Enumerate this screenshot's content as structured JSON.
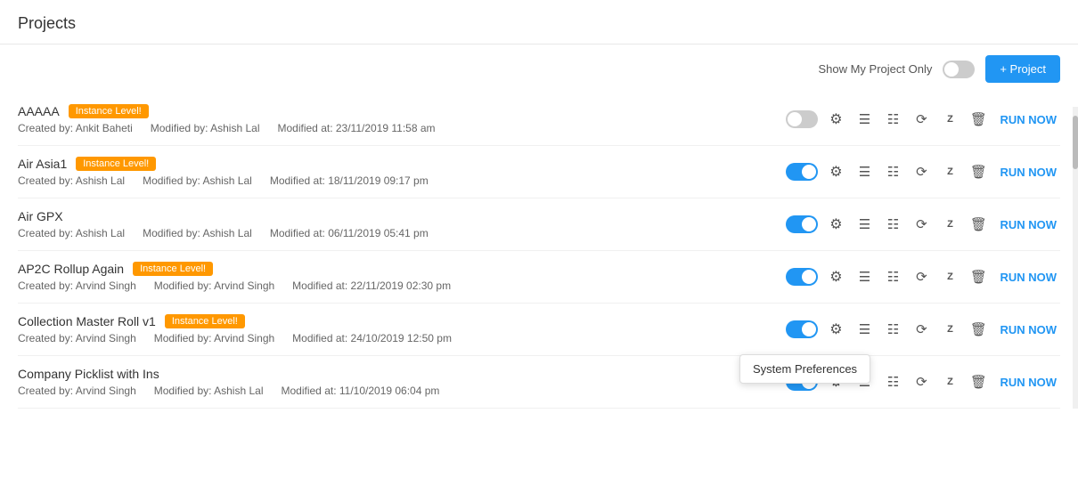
{
  "page": {
    "title": "Projects"
  },
  "toolbar": {
    "show_my_label": "Show My Project Only",
    "add_button_label": "+ Project"
  },
  "projects": [
    {
      "name": "AAAAA",
      "badge": "Instance Level!",
      "created_by": "Created by: Ankit Baheti",
      "modified_by": "Modified by: Ashish Lal",
      "modified_at": "Modified at: 23/11/2019 11:58 am",
      "toggle_on": false,
      "run_now": "RUN NOW"
    },
    {
      "name": "Air Asia1",
      "badge": "Instance Level!",
      "created_by": "Created by: Ashish Lal",
      "modified_by": "Modified by: Ashish Lal",
      "modified_at": "Modified at: 18/11/2019 09:17 pm",
      "toggle_on": true,
      "run_now": "RUN NOW"
    },
    {
      "name": "Air GPX",
      "badge": null,
      "created_by": "Created by: Ashish Lal",
      "modified_by": "Modified by: Ashish Lal",
      "modified_at": "Modified at: 06/11/2019 05:41 pm",
      "toggle_on": true,
      "run_now": "RUN NOW"
    },
    {
      "name": "AP2C Rollup Again",
      "badge": "Instance Level!",
      "created_by": "Created by: Arvind Singh",
      "modified_by": "Modified by: Arvind Singh",
      "modified_at": "Modified at: 22/11/2019 02:30 pm",
      "toggle_on": true,
      "run_now": "RUN NOW"
    },
    {
      "name": "Collection Master Roll v1",
      "badge": "Instance Level!",
      "created_by": "Created by: Arvind Singh",
      "modified_by": "Modified by: Arvind Singh",
      "modified_at": "Modified at: 24/10/2019 12:50 pm",
      "toggle_on": true,
      "run_now": "RUN NOW"
    },
    {
      "name": "Company Picklist with Ins",
      "badge": null,
      "created_by": "Created by: Arvind Singh",
      "modified_by": "Modified by: Ashish Lal",
      "modified_at": "Modified at: 11/10/2019 06:04 pm",
      "toggle_on": true,
      "run_now": "RUN NOW"
    }
  ],
  "tooltip": {
    "label": "System Preferences"
  }
}
